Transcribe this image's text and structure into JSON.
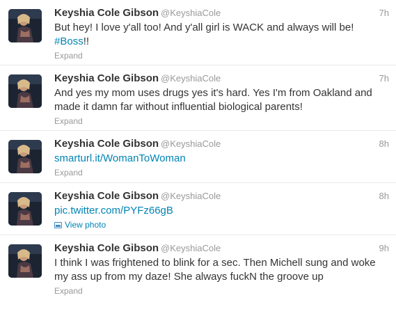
{
  "tweets": [
    {
      "fullname": "Keyshia Cole Gibson",
      "username": "@KeyshiaCole",
      "time": "7h",
      "text_line1": "But hey! I love y'all too! And y'all girl is WACK and always will be!",
      "hashtag": "#Boss",
      "text_after_hashtag": "!!",
      "action": "Expand"
    },
    {
      "fullname": "Keyshia Cole Gibson",
      "username": "@KeyshiaCole",
      "time": "7h",
      "text_line1": "And yes my mom uses drugs yes it's hard. Yes I'm from Oakland and",
      "text_line2": "made it damn far without influential biological parents!",
      "action": "Expand"
    },
    {
      "fullname": "Keyshia Cole Gibson",
      "username": "@KeyshiaCole",
      "time": "8h",
      "link": "smarturl.it/WomanToWoman",
      "action": "Expand"
    },
    {
      "fullname": "Keyshia Cole Gibson",
      "username": "@KeyshiaCole",
      "time": "8h",
      "link": "pic.twitter.com/PYFz66gB",
      "action": "View photo"
    },
    {
      "fullname": "Keyshia Cole Gibson",
      "username": "@KeyshiaCole",
      "time": "9h",
      "text_line1": "I think I was frightened to blink for a sec. Then Michell sung and woke",
      "text_line2": "my ass up from my daze! She always fuckN the groove up",
      "action": "Expand"
    }
  ],
  "colors": {
    "link": "#0084b4",
    "muted": "#999999",
    "text": "#333333",
    "divider": "#e8e8e8"
  },
  "icons": {
    "avatar": "profile-photo",
    "view_photo": "photo-icon"
  }
}
